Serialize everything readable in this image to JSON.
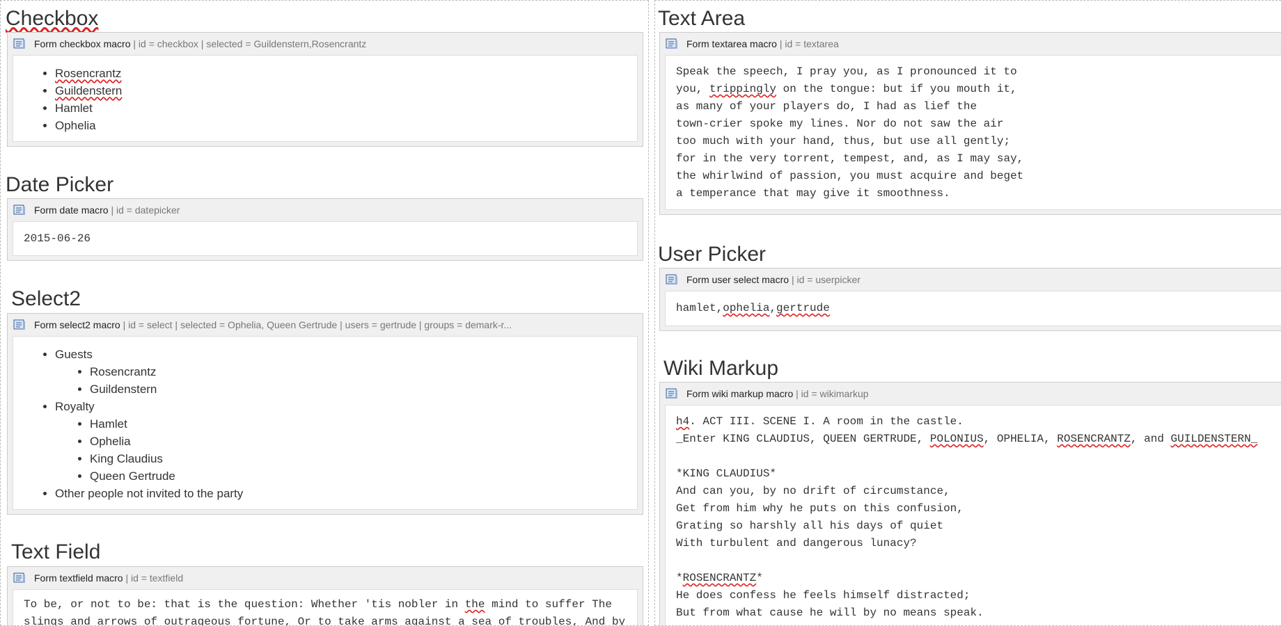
{
  "checkbox": {
    "title": "Checkbox",
    "macro_name": "Form checkbox macro",
    "macro_params": "| id = checkbox | selected = Guildenstern,Rosencrantz",
    "items": [
      "Rosencrantz",
      "Guildenstern",
      "Hamlet",
      "Ophelia"
    ]
  },
  "datepicker": {
    "title": "Date Picker",
    "macro_name": "Form date macro",
    "macro_params": "| id = datepicker",
    "value": "2015-06-26"
  },
  "select2": {
    "title": "Select2",
    "macro_name": "Form select2 macro",
    "macro_params": "| id = select | selected = Ophelia, Queen Gertrude | users = gertrude | groups = demark-r...",
    "groups": [
      {
        "label": "Guests",
        "items": [
          "Rosencrantz",
          "Guildenstern"
        ]
      },
      {
        "label": "Royalty",
        "items": [
          "Hamlet",
          "Ophelia",
          "King Claudius",
          "Queen Gertrude"
        ]
      }
    ],
    "other": "Other people not invited to the party"
  },
  "textfield": {
    "title": "Text Field",
    "macro_name": "Form textfield macro",
    "macro_params": "| id = textfield",
    "line1a": "To be, or not to be: that is the question: Whether 'tis nobler in ",
    "line1b": "the",
    "line1c": " mind to suffer The",
    "line2": "slings and arrows of outrageous fortune, Or to take arms against a sea of troubles, And by"
  },
  "textarea": {
    "title": "Text Area",
    "macro_name": "Form textarea macro",
    "macro_params": "| id = textarea",
    "line1": "Speak the speech, I pray you, as I pronounced it to",
    "line2a": "you, ",
    "line2b": "trippingly",
    "line2c": " on the tongue: but if you mouth it,",
    "line3": "as many of your players do, I had as lief the",
    "line4": "town-crier spoke my lines. Nor do not saw the air",
    "line5": "too much with your hand, thus, but use all gently;",
    "line6": "for in the very torrent, tempest, and, as I may say,",
    "line7": "the whirlwind of passion, you must acquire and beget",
    "line8": "a temperance that may give it smoothness."
  },
  "userpicker": {
    "title": "User Picker",
    "macro_name": "Form user select macro",
    "macro_params": "| id = userpicker",
    "u1": "hamlet",
    "c1": ",",
    "u2": "ophelia",
    "c2": ",",
    "u3": "gertrude"
  },
  "wikimarkup": {
    "title": "Wiki Markup",
    "macro_name": "Form wiki markup macro",
    "macro_params": "| id = wikimarkup",
    "l1a": "h4",
    "l1b": ". ACT III. SCENE I. A room in the castle.",
    "l2a": "_Enter KING CLAUDIUS, QUEEN GERTRUDE, ",
    "l2b": "POLONIUS",
    "l2c": ", OPHELIA, ",
    "l2d": "ROSENCRANTZ",
    "l2e": ", and ",
    "l2f": "GUILDENSTERN_",
    "l4": "*KING CLAUDIUS*",
    "l5": "And can you, by no drift of circumstance,",
    "l6": "Get from him why he puts on this confusion,",
    "l7": "Grating so harshly all his days of quiet",
    "l8": "With turbulent and dangerous lunacy?",
    "l10a": "*",
    "l10b": "ROSENCRANTZ",
    "l10c": "*",
    "l11": "He does confess he feels himself distracted;",
    "l12": "But from what cause he will by no means speak."
  }
}
